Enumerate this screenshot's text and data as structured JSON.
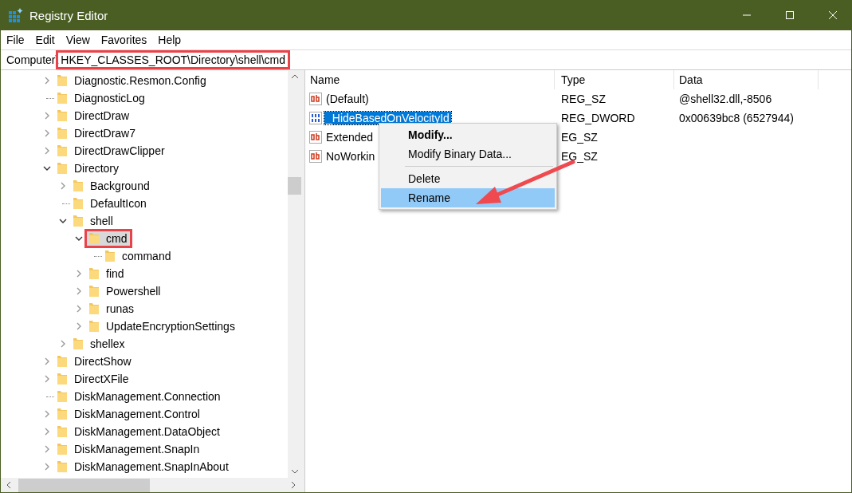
{
  "window": {
    "title": "Registry Editor"
  },
  "menu": [
    "File",
    "Edit",
    "View",
    "Favorites",
    "Help"
  ],
  "address": {
    "prefix": "Computer\\",
    "path": "HKEY_CLASSES_ROOT\\Directory\\shell\\cmd",
    "highlighted": true
  },
  "tree": [
    {
      "label": "Diagnostic.Resmon.Config",
      "kind": "branch",
      "expanded": false,
      "selected": false
    },
    {
      "label": "DiagnosticLog",
      "kind": "leaf",
      "selected": false
    },
    {
      "label": "DirectDraw",
      "kind": "branch",
      "expanded": false,
      "selected": false
    },
    {
      "label": "DirectDraw7",
      "kind": "branch",
      "expanded": false,
      "selected": false
    },
    {
      "label": "DirectDrawClipper",
      "kind": "branch",
      "expanded": false,
      "selected": false
    },
    {
      "label": "Directory",
      "kind": "branch",
      "expanded": true,
      "selected": false,
      "children": [
        {
          "label": "Background",
          "kind": "branch",
          "expanded": false,
          "selected": false
        },
        {
          "label": "DefaultIcon",
          "kind": "leaf",
          "selected": false
        },
        {
          "label": "shell",
          "kind": "branch",
          "expanded": true,
          "selected": false,
          "children": [
            {
              "label": "cmd",
              "kind": "branch",
              "expanded": true,
              "selected": true,
              "highlighted": true,
              "children": [
                {
                  "label": "command",
                  "kind": "leaf",
                  "selected": false
                }
              ]
            },
            {
              "label": "find",
              "kind": "branch",
              "expanded": false,
              "selected": false
            },
            {
              "label": "Powershell",
              "kind": "branch",
              "expanded": false,
              "selected": false
            },
            {
              "label": "runas",
              "kind": "branch",
              "expanded": false,
              "selected": false
            },
            {
              "label": "UpdateEncryptionSettings",
              "kind": "branch",
              "expanded": false,
              "selected": false
            }
          ]
        },
        {
          "label": "shellex",
          "kind": "branch",
          "expanded": false,
          "selected": false
        }
      ]
    },
    {
      "label": "DirectShow",
      "kind": "branch",
      "expanded": false,
      "selected": false
    },
    {
      "label": "DirectXFile",
      "kind": "branch",
      "expanded": false,
      "selected": false
    },
    {
      "label": "DiskManagement.Connection",
      "kind": "leaf",
      "selected": false
    },
    {
      "label": "DiskManagement.Control",
      "kind": "branch",
      "expanded": false,
      "selected": false
    },
    {
      "label": "DiskManagement.DataObject",
      "kind": "branch",
      "expanded": false,
      "selected": false
    },
    {
      "label": "DiskManagement.SnapIn",
      "kind": "branch",
      "expanded": false,
      "selected": false
    },
    {
      "label": "DiskManagement.SnapInAbout",
      "kind": "branch",
      "expanded": false,
      "selected": false
    }
  ],
  "columns": [
    "Name",
    "Type",
    "Data"
  ],
  "values": [
    {
      "name": "(Default)",
      "type": "REG_SZ",
      "data": "@shell32.dll,-8506",
      "kind": "string",
      "selected": false
    },
    {
      "name": "_HideBasedOnVelocityId",
      "type": "REG_DWORD",
      "data": "0x00639bc8 (6527944)",
      "kind": "binary",
      "selected": true
    },
    {
      "name": "Extended",
      "type": "EG_SZ",
      "kind": "string",
      "selected": false
    },
    {
      "name": "NoWorkin",
      "type": "EG_SZ",
      "kind": "string",
      "selected": false
    }
  ],
  "context_menu": [
    {
      "kind": "item",
      "label": "Modify...",
      "default": true,
      "selected": false
    },
    {
      "kind": "item",
      "label": "Modify Binary Data...",
      "default": false,
      "selected": false
    },
    {
      "kind": "separator"
    },
    {
      "kind": "item",
      "label": "Delete",
      "default": false,
      "selected": false
    },
    {
      "kind": "item",
      "label": "Rename",
      "default": false,
      "selected": true
    }
  ]
}
